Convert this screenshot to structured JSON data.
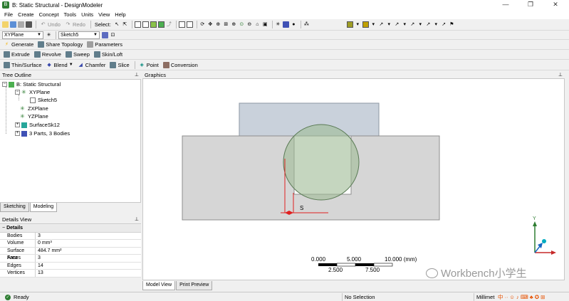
{
  "window": {
    "title": "B: Static Structural - DesignModeler",
    "min": "—",
    "max": "❐",
    "close": "✕"
  },
  "menu": [
    "File",
    "Create",
    "Concept",
    "Tools",
    "Units",
    "View",
    "Help"
  ],
  "toolbar1": {
    "select_label": "Select:",
    "undo": "Undo",
    "redo": "Redo"
  },
  "toolbar2": {
    "plane": "XYPlane",
    "sketch": "Sketch5"
  },
  "toolbar3": {
    "generate": "Generate",
    "share_topology": "Share Topology",
    "parameters": "Parameters"
  },
  "toolbar4": {
    "extrude": "Extrude",
    "revolve": "Revolve",
    "sweep": "Sweep",
    "skin_loft": "Skin/Loft"
  },
  "toolbar5": {
    "thin_surface": "Thin/Surface",
    "blend": "Blend",
    "chamfer": "Chamfer",
    "slice": "Slice",
    "point": "Point",
    "conversion": "Conversion"
  },
  "tree": {
    "header": "Tree Outline",
    "nodes": [
      "B: Static Structural",
      "XYPlane",
      "Sketch5",
      "ZXPlane",
      "YZPlane",
      "SurfaceSk12",
      "3 Parts, 3 Bodies"
    ]
  },
  "tabs": {
    "sketching": "Sketching",
    "modeling": "Modeling"
  },
  "details": {
    "header": "Details View",
    "group": "Details",
    "rows": [
      {
        "k": "Bodies",
        "v": "3"
      },
      {
        "k": "Volume",
        "v": "0 mm³"
      },
      {
        "k": "Surface Area",
        "v": "484.7 mm²"
      },
      {
        "k": "Faces",
        "v": "3"
      },
      {
        "k": "Edges",
        "v": "14"
      },
      {
        "k": "Vertices",
        "v": "13"
      }
    ]
  },
  "graphics": {
    "header": "Graphics",
    "dimension_label": "S",
    "scale": {
      "top": [
        "0.000",
        "5.000",
        "10.000 (mm)"
      ],
      "bottom": [
        "2.500",
        "7.500"
      ]
    },
    "axis_y": "Y"
  },
  "graphics_tabs": {
    "model_view": "Model View",
    "print_preview": "Print Preview"
  },
  "status": {
    "ready": "Ready",
    "selection": "No Selection",
    "units": "Millimet"
  },
  "watermark": "Workbench小学生",
  "colors": {
    "body": "#d6d6d6",
    "upper": "#c9d1db",
    "circle": "#9fba95",
    "dim": "#e02020"
  }
}
